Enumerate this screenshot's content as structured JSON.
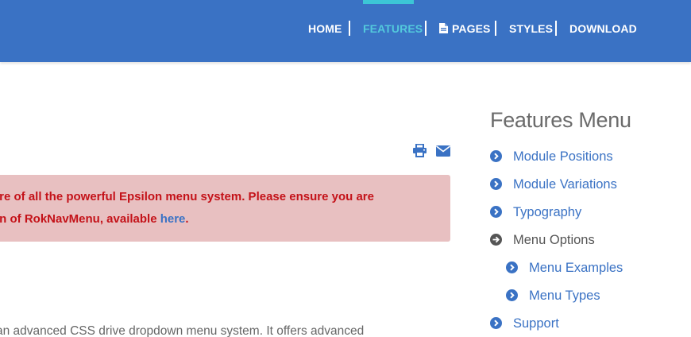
{
  "nav": {
    "items": [
      {
        "label": "HOME"
      },
      {
        "label": "FEATURES"
      },
      {
        "label": "PAGES"
      },
      {
        "label": "STYLES"
      },
      {
        "label": "DOWNLOAD"
      }
    ],
    "active": "FEATURES"
  },
  "toolbar": {
    "icons": [
      "print-icon",
      "email-icon"
    ]
  },
  "alert": {
    "line1": "ore of all the powerful Epsilon menu system. Please ensure you are",
    "line2_prefix": "on of RokNavMenu, available ",
    "link_text": "here",
    "line2_suffix": "."
  },
  "body_text": "an advanced CSS drive dropdown menu system. It offers advanced",
  "sidebar": {
    "title": "Features Menu",
    "items": [
      {
        "label": "Module Positions"
      },
      {
        "label": "Module Variations"
      },
      {
        "label": "Typography"
      },
      {
        "label": "Menu Options"
      },
      {
        "label": "Menu Examples"
      },
      {
        "label": "Menu Types"
      },
      {
        "label": "Support"
      }
    ]
  },
  "colors": {
    "header": "#3a72c4",
    "active_nav": "#53c9dc",
    "alert_bg": "#e8c0c1",
    "alert_text": "#c41219",
    "link": "#3a72c4"
  }
}
